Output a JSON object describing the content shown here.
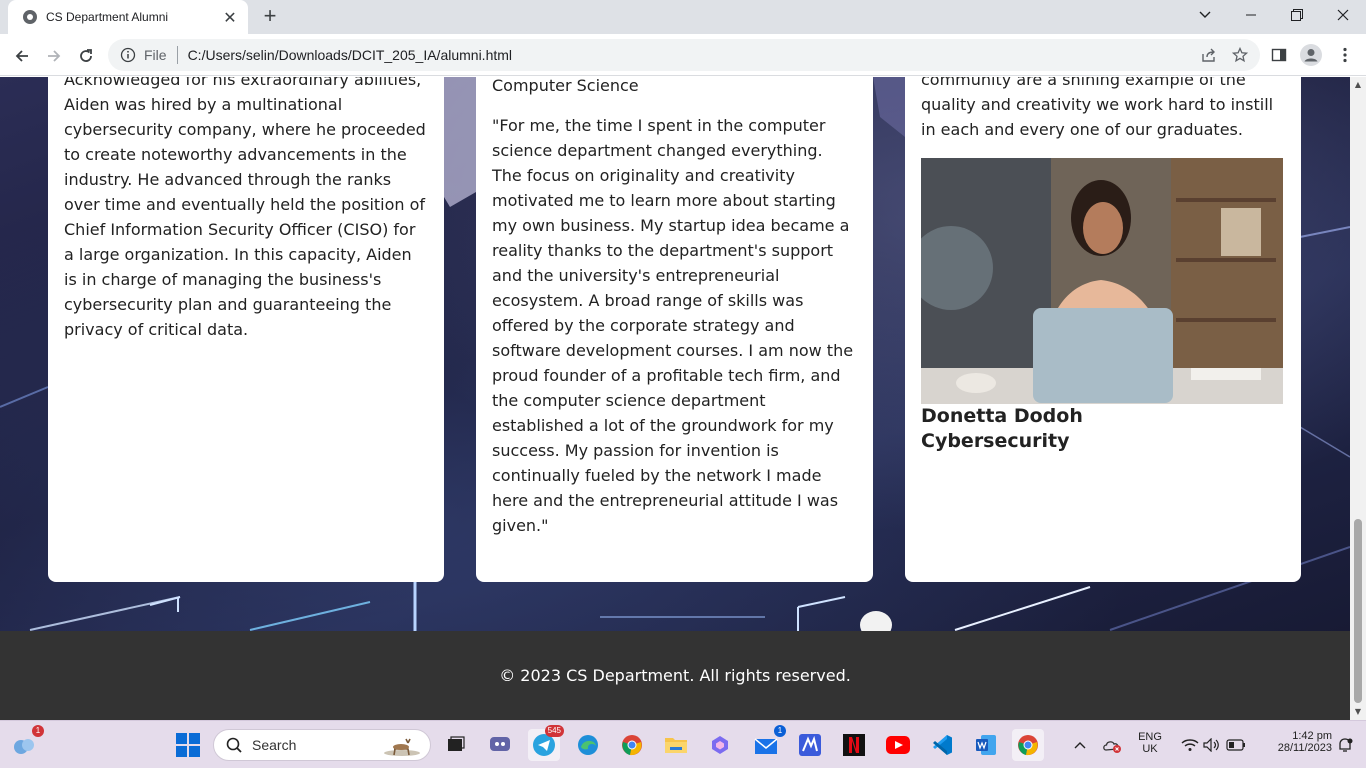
{
  "browser": {
    "tab_title": "CS Department Alumni",
    "file_label": "File",
    "url": "C:/Users/selin/Downloads/DCIT_205_IA/alumni.html"
  },
  "cards": [
    {
      "text": "Acknowledged for his extraordinary abilities, Aiden was hired by a multinational cybersecurity company, where he proceeded to create noteworthy advancements in the industry. He advanced through the ranks over time and eventually held the position of Chief Information Security Officer (CISO) for a large organization. In this capacity, Aiden is in charge of managing the business's cybersecurity plan and guaranteeing the privacy of critical data."
    },
    {
      "field": "Computer Science",
      "quote": "\"For me, the time I spent in the computer science department changed everything. The focus on originality and creativity motivated me to learn more about starting my own business. My startup idea became a reality thanks to the department's support and the university's entrepreneurial ecosystem. A broad range of skills was offered by the corporate strategy and software development courses. I am now the proud founder of a profitable tech firm, and the computer science department established a lot of the groundwork for my success. My passion for invention is continually fueled by the network I made here and the entrepreneurial attitude I was given.\""
    },
    {
      "text": "community are a shining example of the quality and creativity we work hard to instill in each and every one of our graduates.",
      "name": "Donetta Dodoh",
      "field": "Cybersecurity"
    }
  ],
  "footer": {
    "copyright": "© 2023 CS Department. All rights reserved."
  },
  "taskbar": {
    "search_placeholder": "Search",
    "notification_badge": "1",
    "telegram_badge": "545",
    "mail_badge": "1",
    "lang_top": "ENG",
    "lang_bottom": "UK",
    "time": "1:42 pm",
    "date": "28/11/2023"
  }
}
